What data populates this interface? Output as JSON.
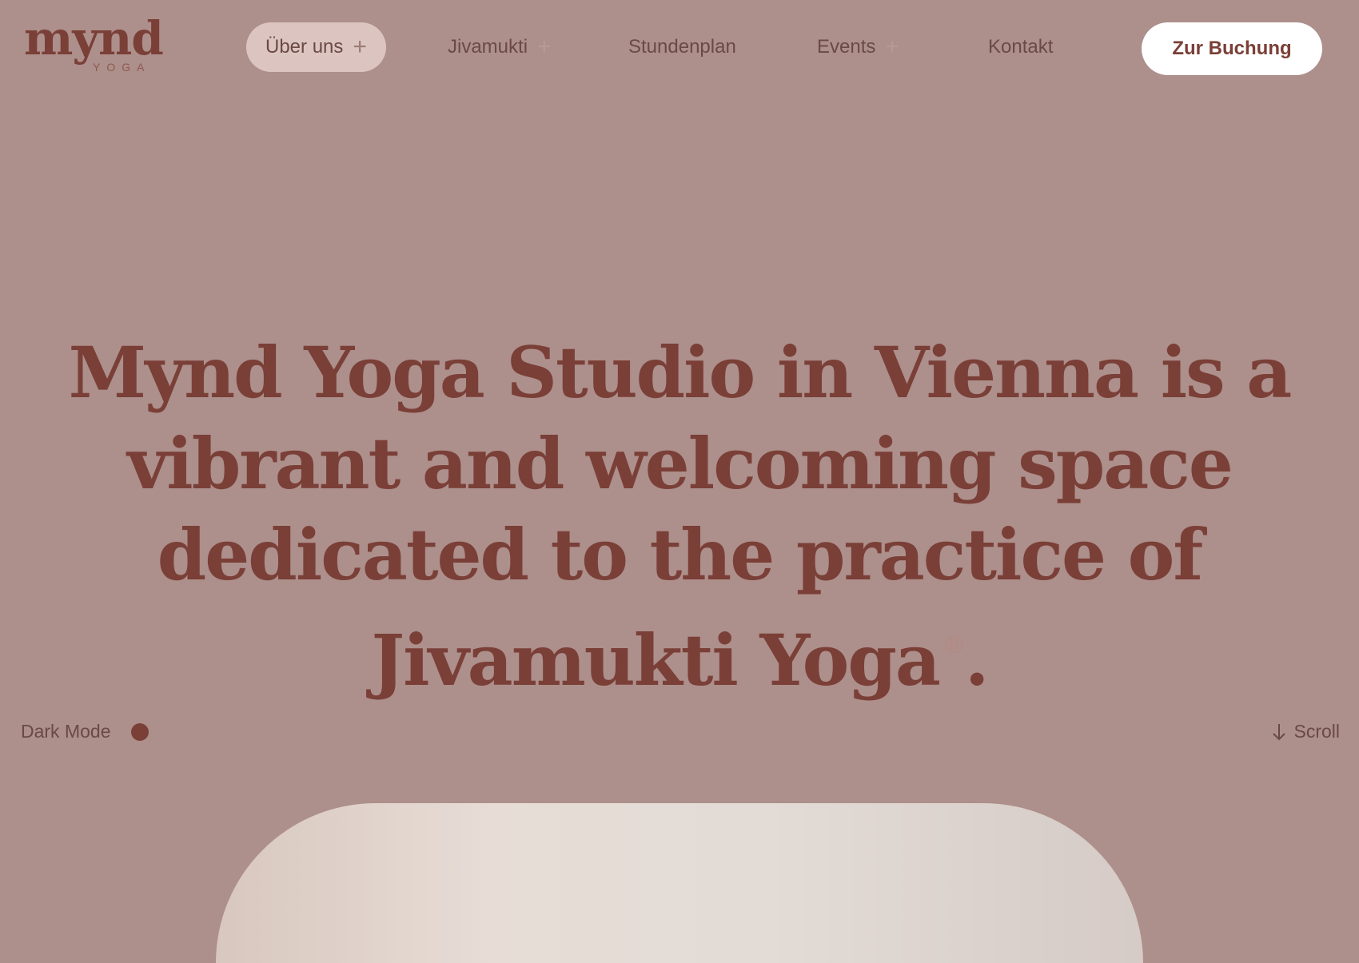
{
  "logo": {
    "name": "mynd",
    "sub": "YOGA"
  },
  "nav": {
    "items": [
      {
        "label": "Über uns",
        "has_plus": true,
        "active": true
      },
      {
        "label": "Jivamukti",
        "has_plus": true,
        "active": false
      },
      {
        "label": "Stundenplan",
        "has_plus": false,
        "active": false
      },
      {
        "label": "Events",
        "has_plus": true,
        "active": false
      },
      {
        "label": "Kontakt",
        "has_plus": false,
        "active": false
      }
    ],
    "plus_symbol": "+",
    "cta_label": "Zur Buchung"
  },
  "hero": {
    "line1": "Mynd Yoga Studio in Vienna is a",
    "line2": "vibrant and welcoming space",
    "line3": "dedicated to the practice of",
    "line4_text": "Jivamukti Yoga",
    "line4_mark": "®",
    "line4_end": "."
  },
  "controls": {
    "dark_mode_label": "Dark Mode",
    "scroll_label": "Scroll"
  },
  "colors": {
    "background": "#ad8f8b",
    "brand": "#7a3f37",
    "active_pill": "#dcc5c1",
    "cta_bg": "#ffffff"
  },
  "icons": {
    "plus": "plus-icon",
    "scroll": "arrow-down-icon",
    "toggle": "dark-mode-dot-icon"
  }
}
